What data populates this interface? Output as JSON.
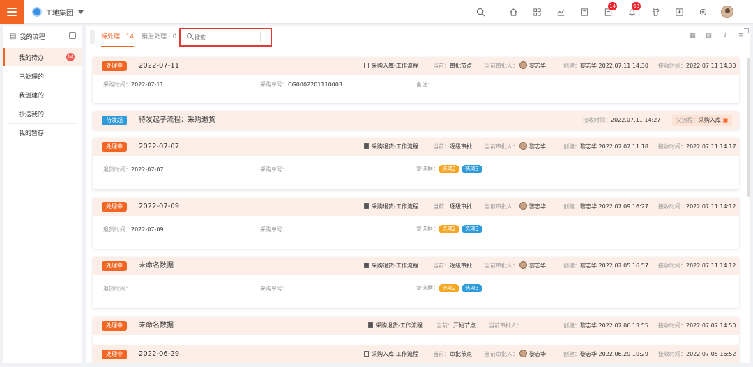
{
  "org": {
    "name": "工地集团"
  },
  "top": {
    "badge_messages": "14",
    "badge_notify": "68"
  },
  "sidebar": {
    "header": "我的流程",
    "items": [
      {
        "label": "我的待办",
        "badge": "14"
      },
      {
        "label": "已处理的"
      },
      {
        "label": "我创建的"
      },
      {
        "label": "抄送我的"
      },
      {
        "label": "我的暂存"
      }
    ]
  },
  "tabs": [
    {
      "label": "待处理 · 14"
    },
    {
      "label": "稍后处理 · 0"
    }
  ],
  "search": {
    "placeholder": "搜索",
    "value": ""
  },
  "cards": [
    {
      "status": "处理中",
      "title": "2022-07-11",
      "workflow": "采购入库-工作流程",
      "current_label": "当前：",
      "current": "审批节点",
      "approver_label": "当前审批人：",
      "approver": "黎志华",
      "creator_label": "创建：",
      "creator": "黎志华",
      "created": "2022.07.11 14:30",
      "received_label": "接收时间：",
      "received": "2022.07.11 14:30",
      "f1_label": "采购时间：",
      "f1": "2022-07-11",
      "f2_label": "采购单号：",
      "f2": "CG0002201110003",
      "f3_label": "备注：",
      "f3": ""
    },
    {
      "status": "待发起",
      "title_prefix": "待发起子流程：",
      "title": "采购退货",
      "received_label": "接收时间：",
      "received": "2022.07.11 14:27",
      "parent_label": "父流程：",
      "parent": "采购入库"
    },
    {
      "status": "处理中",
      "title": "2022-07-07",
      "workflow": "采购退货-工作流程",
      "current_label": "当前：",
      "current": "逐级审批",
      "approver_label": "当前审批人：",
      "approver": "黎志华",
      "creator_label": "创建：",
      "creator": "黎志华",
      "created": "2022.07.07 11:18",
      "received_label": "接收时间：",
      "received": "2022.07.11 14:17",
      "f1_label": "退货时间：",
      "f1": "2022-07-07",
      "f2_label": "采购单号：",
      "f2": "",
      "f3_label": "复选框：",
      "chip1": "选项2",
      "chip2": "选项3"
    },
    {
      "status": "处理中",
      "title": "2022-07-09",
      "workflow": "采购退货-工作流程",
      "current_label": "当前：",
      "current": "逐级审批",
      "approver_label": "当前审批人：",
      "approver": "黎志华",
      "creator_label": "创建：",
      "creator": "黎志华",
      "created": "2022.07.09 16:27",
      "received_label": "接收时间：",
      "received": "2022.07.11 14:12",
      "f1_label": "退货时间：",
      "f1": "2022-07-09",
      "f2_label": "采购单号：",
      "f2": "",
      "f3_label": "复选框：",
      "chip1": "选项2",
      "chip2": "选项3"
    },
    {
      "status": "处理中",
      "title": "未命名数据",
      "workflow": "采购退货-工作流程",
      "current_label": "当前：",
      "current": "逐级审批",
      "approver_label": "当前审批人：",
      "approver": "黎志华",
      "creator_label": "创建：",
      "creator": "黎志华",
      "created": "2022.07.05 16:57",
      "received_label": "接收时间：",
      "received": "2022.07.11 14:12",
      "f1_label": "退货时间：",
      "f1": "",
      "f2_label": "采购单号：",
      "f2": "",
      "f3_label": "复选框：",
      "chip1": "选项2",
      "chip2": "选项3"
    },
    {
      "status": "处理中",
      "title": "未命名数据",
      "workflow": "采购退货-工作流程",
      "current_label": "当前：",
      "current": "开始节点",
      "approver_label": "当前审批人：",
      "approver": "",
      "creator_label": "创建：",
      "creator": "黎志华",
      "created": "2022.07.06 13:55",
      "received_label": "接收时间：",
      "received": "2022.07.07 14:50"
    },
    {
      "status": "处理中",
      "title": "2022-06-29",
      "workflow": "采购入库-工作流程",
      "current_label": "当前：",
      "current": "审批节点",
      "approver_label": "当前审批人：",
      "approver": "黎志华",
      "creator_label": "创建：",
      "creator": "黎志华",
      "created": "2022.06.29 10:29",
      "received_label": "接收时间：",
      "received": "2022.07.05 16:52"
    }
  ]
}
